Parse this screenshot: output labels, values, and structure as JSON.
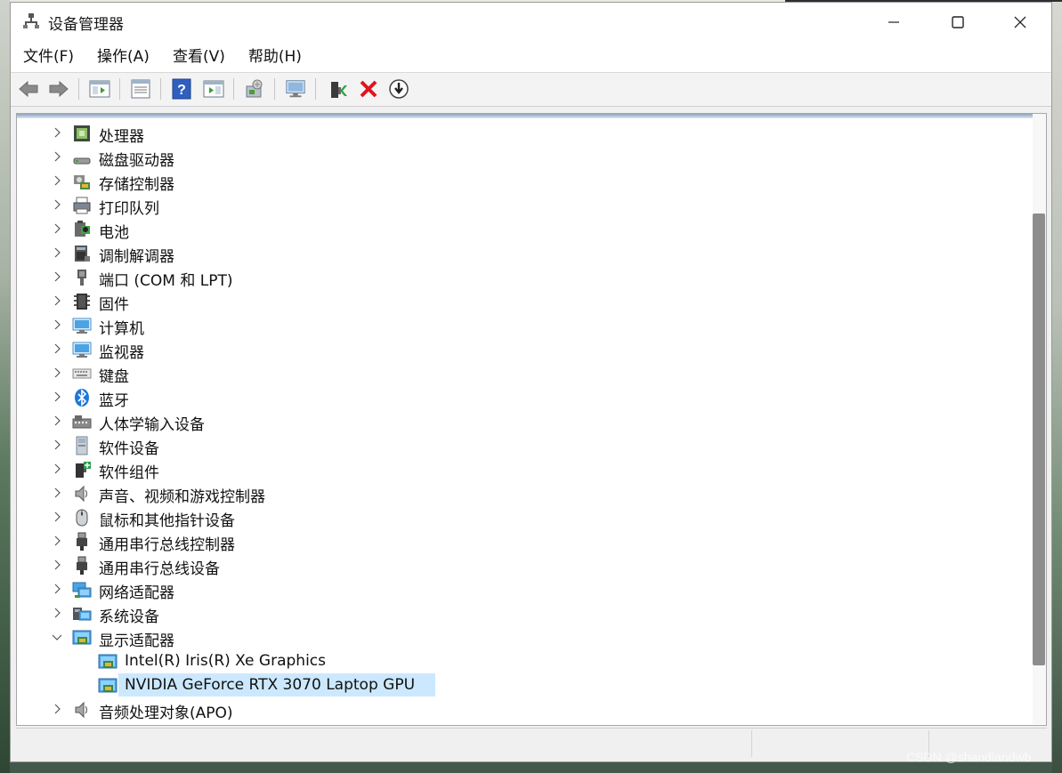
{
  "window": {
    "title": "设备管理器",
    "controls": {
      "minimize": "minimize-icon",
      "maximize": "maximize-icon",
      "close": "close-icon"
    }
  },
  "menubar": {
    "items": [
      {
        "label": "文件(F)"
      },
      {
        "label": "操作(A)"
      },
      {
        "label": "查看(V)"
      },
      {
        "label": "帮助(H)"
      }
    ]
  },
  "toolbar": {
    "buttons": [
      "back-icon",
      "forward-icon",
      "show-hide-console-tree-icon",
      "properties-icon",
      "help-icon",
      "action-pane-icon",
      "scan-hardware-icon",
      "update-driver-icon",
      "enable-device-icon",
      "uninstall-device-icon",
      "disable-device-icon"
    ]
  },
  "tree": {
    "categories": [
      {
        "label": "处理器",
        "icon": "processor-icon",
        "expanded": false
      },
      {
        "label": "磁盘驱动器",
        "icon": "disk-drive-icon",
        "expanded": false
      },
      {
        "label": "存储控制器",
        "icon": "storage-controller-icon",
        "expanded": false
      },
      {
        "label": "打印队列",
        "icon": "printer-icon",
        "expanded": false
      },
      {
        "label": "电池",
        "icon": "battery-icon",
        "expanded": false
      },
      {
        "label": "调制解调器",
        "icon": "modem-icon",
        "expanded": false
      },
      {
        "label": "端口 (COM 和 LPT)",
        "icon": "port-icon",
        "expanded": false
      },
      {
        "label": "固件",
        "icon": "firmware-icon",
        "expanded": false
      },
      {
        "label": "计算机",
        "icon": "computer-icon",
        "expanded": false
      },
      {
        "label": "监视器",
        "icon": "monitor-icon",
        "expanded": false
      },
      {
        "label": "键盘",
        "icon": "keyboard-icon",
        "expanded": false
      },
      {
        "label": "蓝牙",
        "icon": "bluetooth-icon",
        "expanded": false
      },
      {
        "label": "人体学输入设备",
        "icon": "hid-icon",
        "expanded": false
      },
      {
        "label": "软件设备",
        "icon": "software-device-icon",
        "expanded": false
      },
      {
        "label": "软件组件",
        "icon": "software-component-icon",
        "expanded": false
      },
      {
        "label": "声音、视频和游戏控制器",
        "icon": "sound-icon",
        "expanded": false
      },
      {
        "label": "鼠标和其他指针设备",
        "icon": "mouse-icon",
        "expanded": false
      },
      {
        "label": "通用串行总线控制器",
        "icon": "usb-icon",
        "expanded": false
      },
      {
        "label": "通用串行总线设备",
        "icon": "usb-icon",
        "expanded": false
      },
      {
        "label": "网络适配器",
        "icon": "network-icon",
        "expanded": false
      },
      {
        "label": "系统设备",
        "icon": "system-device-icon",
        "expanded": false
      },
      {
        "label": "显示适配器",
        "icon": "display-adapter-icon",
        "expanded": true
      },
      {
        "label": "音频处理对象(APO)",
        "icon": "sound-icon",
        "expanded": false
      }
    ],
    "display_adapters": [
      {
        "label": "Intel(R) Iris(R) Xe Graphics",
        "selected": false
      },
      {
        "label": "NVIDIA GeForce RTX 3070 Laptop GPU",
        "selected": true
      }
    ]
  },
  "watermark": "CSDN @shandiandwb"
}
